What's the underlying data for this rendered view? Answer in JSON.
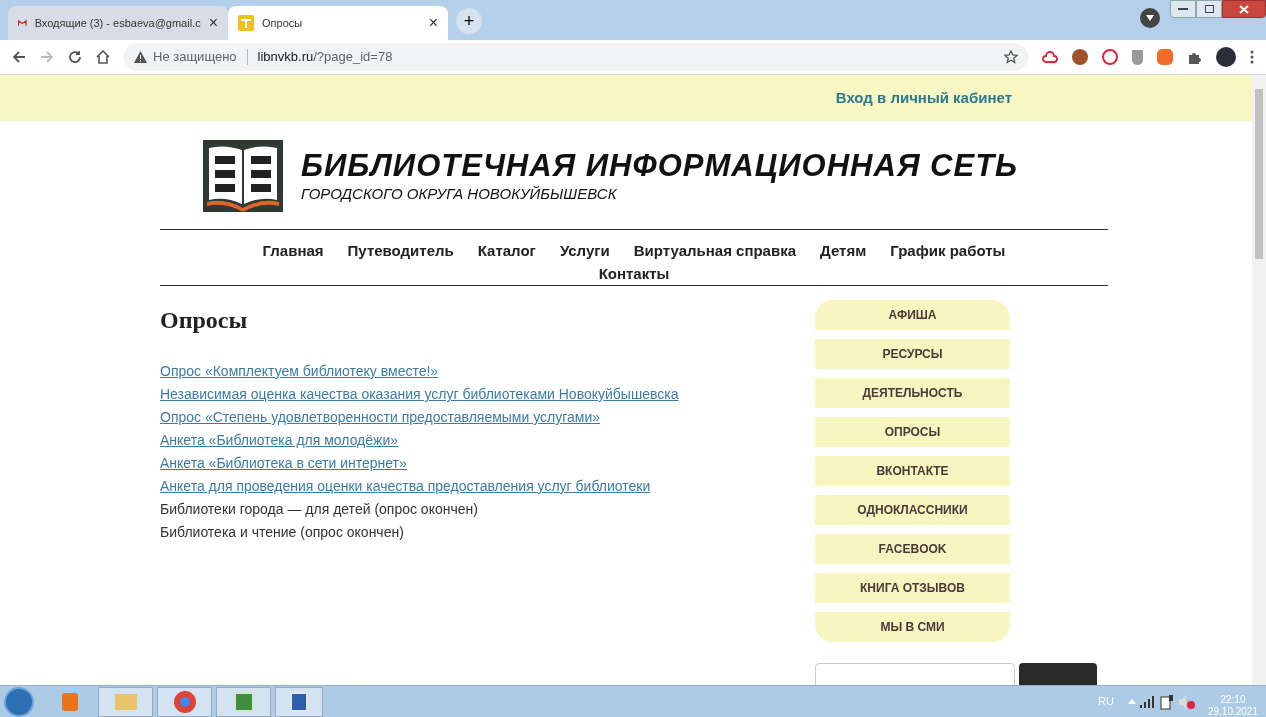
{
  "browser": {
    "tabs": [
      {
        "title": "Входящие (3) - esbaeva@gmail.c",
        "selected": false,
        "close": "×"
      },
      {
        "title": "Опросы",
        "selected": true,
        "close": "×"
      }
    ],
    "new_tab": "+",
    "security": "Не защищено",
    "url_host": "libnvkb.ru",
    "url_path": "/?page_id=78"
  },
  "top_bar": {
    "login_link": "Вход в личный кабинет"
  },
  "header": {
    "title": "БИБЛИОТЕЧНАЯ ИНФОРМАЦИОННАЯ СЕТЬ",
    "subtitle": "ГОРОДСКОГО ОКРУГА НОВОКУЙБЫШЕВСК"
  },
  "nav": {
    "items": [
      "Главная",
      "Путеводитель",
      "Каталог",
      "Услуги",
      "Виртуальная справка",
      "Детям",
      "График работы",
      "Контакты"
    ]
  },
  "page": {
    "heading": "Опросы",
    "items": [
      {
        "text": "Опрос «Комплектуем библиотеку вместе!»",
        "kind": "link"
      },
      {
        "text": "Независимая оценка качества оказания услуг библиотеками Новокуйбышевска",
        "kind": "link"
      },
      {
        "text": "Опрос «Степень удовлетворенности предоставляемыми услугами»",
        "kind": "link"
      },
      {
        "text": "Анкета «Библиотека для молодёжи»",
        "kind": "link"
      },
      {
        "text": "Анкета «Библиотека в сети интернет»",
        "kind": "link"
      },
      {
        "text": "Анкета для проведения оценки качества предоставления услуг библиотеки",
        "kind": "link"
      },
      {
        "text": "Библиотеки города — для детей (опрос окончен)",
        "kind": "text"
      },
      {
        "text": "Библиотека и чтение (опрос окончен)",
        "kind": "text"
      }
    ]
  },
  "sidebar": {
    "items": [
      "АФИША",
      "РЕСУРСЫ",
      "ДЕЯТЕЛЬНОСТЬ",
      "ОПРОСЫ",
      "ВКОНТАКТЕ",
      "ОДНОКЛАССНИКИ",
      "FACEBOOK",
      "КНИГА ОТЗЫВОВ",
      "МЫ В СМИ"
    ]
  },
  "taskbar": {
    "language": "RU",
    "time": "22:10",
    "date": "29.10.2021"
  }
}
